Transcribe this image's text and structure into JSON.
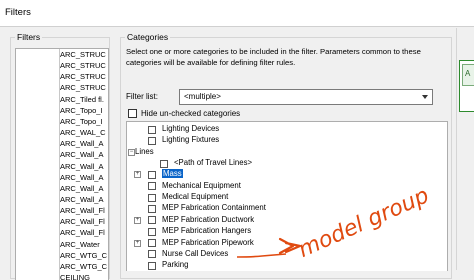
{
  "window": {
    "title": "Filters"
  },
  "filters_panel": {
    "label": "Filters",
    "items": [
      "ARC_STRUC",
      "ARC_STRUC",
      "ARC_STRUC",
      "ARC_STRUC",
      "ARC_Tiled fl.",
      "ARC_Topo_I",
      "ARC_Topo_I",
      "ARC_WAL_C",
      "ARC_Wall_A",
      "ARC_Wall_A",
      "ARC_Wall_A",
      "ARC_Wall_A",
      "ARC_Wall_A",
      "ARC_Wall_A",
      "ARC_Wall_Fl",
      "ARC_Wall_Fl",
      "ARC_Wall_Fl",
      "ARC_Water",
      "ARC_WTG_C",
      "ARC_WTG_C",
      "CEILING"
    ]
  },
  "categories_panel": {
    "label": "Categories",
    "description": "Select one or more categories to be included in the filter.  Parameters common to these categories will be available for defining filter rules.",
    "filter_list_label": "Filter list:",
    "filter_list_value": "<multiple>",
    "hide_unchecked_label": "Hide un-checked categories",
    "tree": [
      {
        "label": "Lighting Devices",
        "level": 1,
        "expander": false
      },
      {
        "label": "Lighting Fixtures",
        "level": 1,
        "expander": false
      },
      {
        "label": "Lines",
        "level": 0,
        "expander": "minus"
      },
      {
        "label": "<Path of Travel Lines>",
        "level": 2,
        "expander": false
      },
      {
        "label": "Mass",
        "level": 1,
        "expander": "plus",
        "selected": true
      },
      {
        "label": "Mechanical Equipment",
        "level": 1,
        "expander": false
      },
      {
        "label": "Medical Equipment",
        "level": 1,
        "expander": false
      },
      {
        "label": "MEP Fabrication Containment",
        "level": 1,
        "expander": false
      },
      {
        "label": "MEP Fabrication Ductwork",
        "level": 1,
        "expander": "plus"
      },
      {
        "label": "MEP Fabrication Hangers",
        "level": 1,
        "expander": false
      },
      {
        "label": "MEP Fabrication Pipework",
        "level": 1,
        "expander": "plus"
      },
      {
        "label": "Nurse Call Devices",
        "level": 1,
        "expander": false
      },
      {
        "label": "Parking",
        "level": 1,
        "expander": false
      }
    ]
  },
  "annotation": {
    "text": "model group",
    "color": "#e04a10"
  },
  "colors": {
    "selection": "#0a64c8",
    "right_panel_border": "#2e8b2e",
    "right_panel_fill": "#e8f3e8"
  }
}
